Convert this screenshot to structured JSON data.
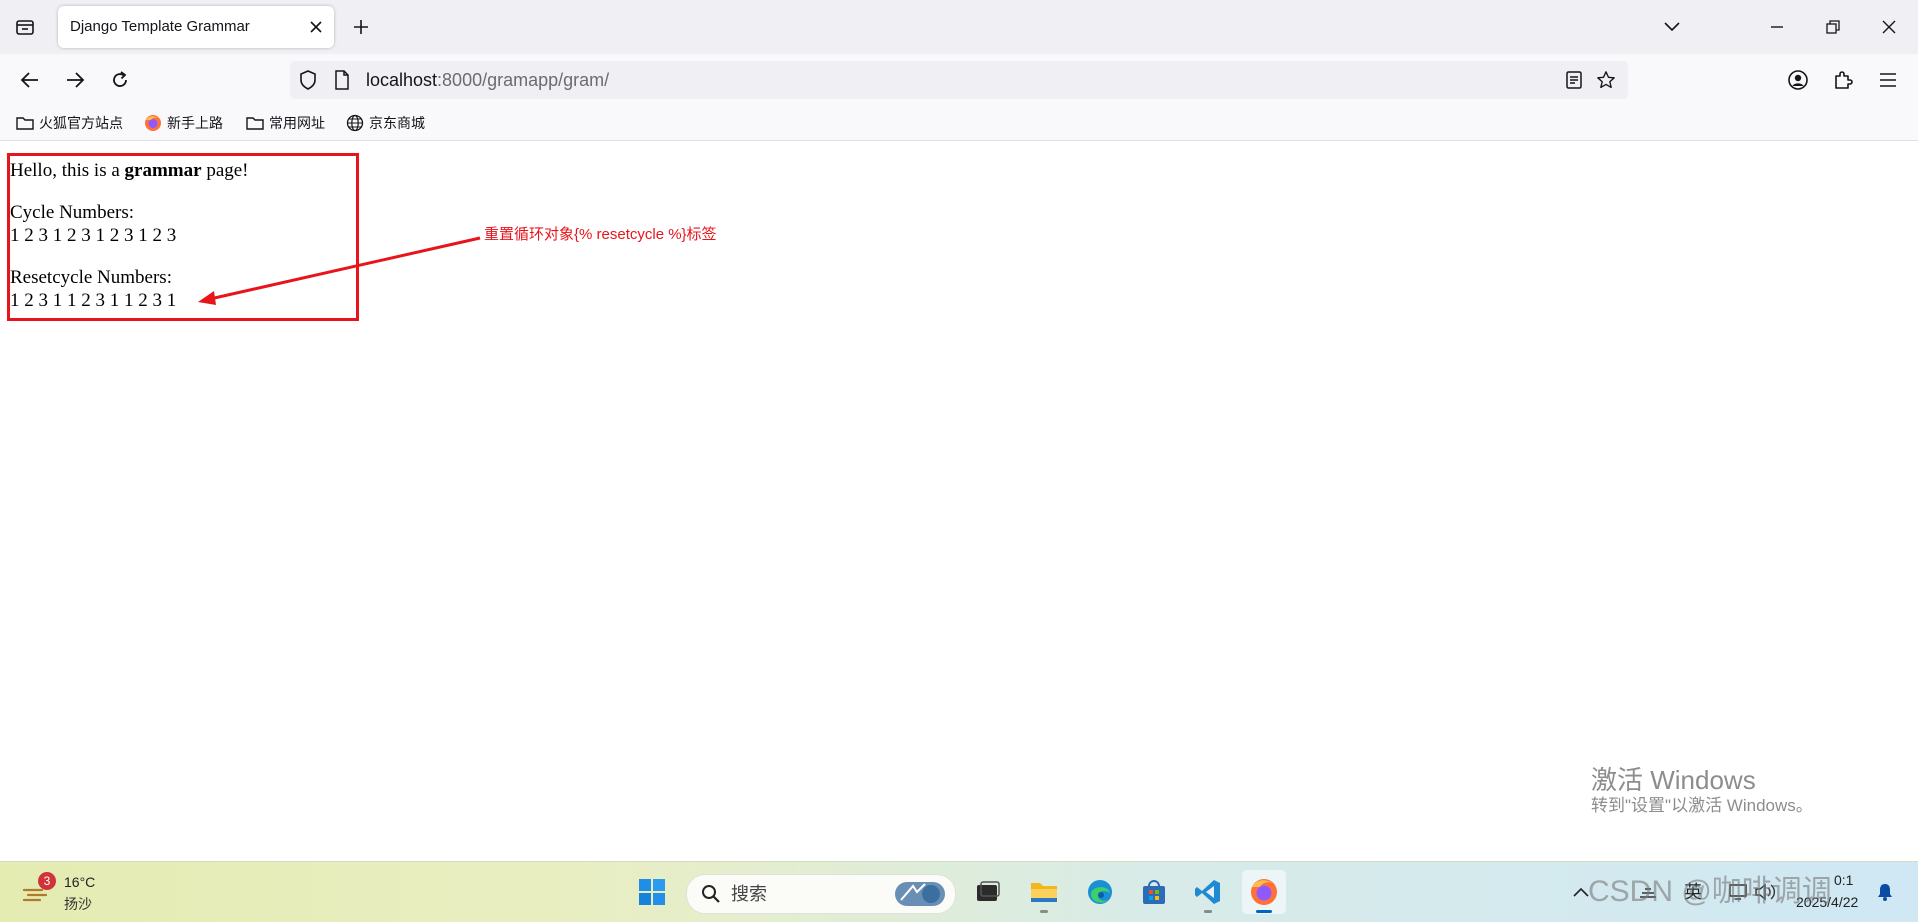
{
  "browser": {
    "tab_title": "Django Template Grammar",
    "url_host": "localhost",
    "url_path": ":8000/gramapp/gram/",
    "bookmarks": [
      "火狐官方站点",
      "新手上路",
      "常用网址",
      "京东商城"
    ]
  },
  "page": {
    "greeting_before": "Hello, this is a ",
    "greeting_bold": "grammar",
    "greeting_after": " page!",
    "cycle_label": "Cycle Numbers:",
    "cycle_values": "1 2 3 1 2 3 1 2 3 1 2 3",
    "resetcycle_label": "Resetcycle Numbers:",
    "resetcycle_values": "1 2 3 1 1 2 3 1 1 2 3 1"
  },
  "annotation": {
    "text": "重置循环对象{% resetcycle %}标签",
    "color": "#e8141b"
  },
  "watermark": {
    "title": "激活 Windows",
    "subtitle": "转到\"设置\"以激活 Windows。"
  },
  "taskbar": {
    "weather_badge": "3",
    "weather_temp": "16°C",
    "weather_desc": "扬沙",
    "search_placeholder": "搜索",
    "ime": "英",
    "clock_time": "0:1",
    "clock_date": "2025/4/22",
    "csdn_watermark": "CSDN @咖啡调调"
  },
  "icons": {
    "tab_overview": "tab-overview-icon",
    "back": "back-arrow-icon",
    "forward": "forward-arrow-icon",
    "reload": "reload-icon",
    "shield": "tracking-protection-icon",
    "page": "page-info-icon",
    "reader": "reader-view-icon",
    "star": "bookmark-star-icon",
    "account": "account-icon",
    "extensions": "extensions-icon",
    "menu": "hamburger-menu-icon"
  }
}
